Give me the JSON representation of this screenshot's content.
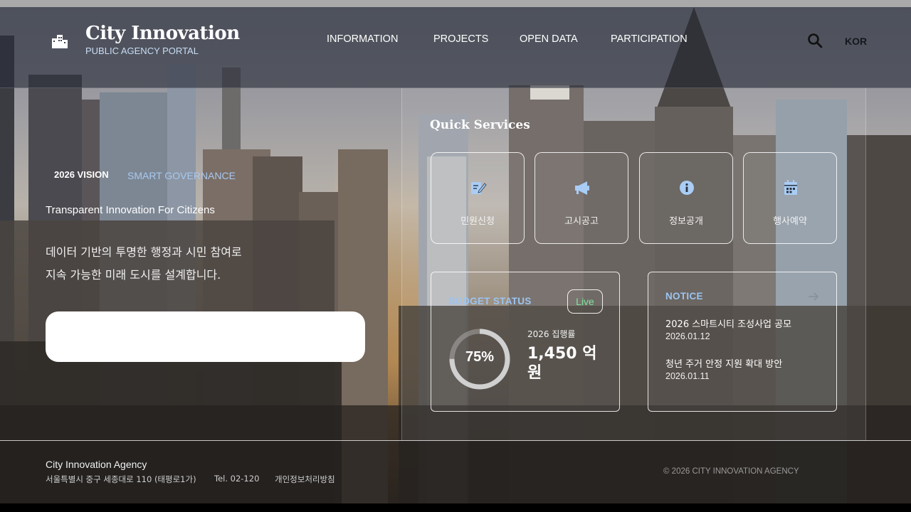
{
  "header": {
    "brand_title": "City Innovation",
    "brand_subtitle": "PUBLIC AGENCY PORTAL",
    "nav": [
      "INFORMATION",
      "PROJECTS",
      "OPEN DATA",
      "PARTICIPATION"
    ],
    "language": "KOR"
  },
  "hero": {
    "tag_primary": "2026 VISION",
    "tag_secondary": "SMART GOVERNANCE",
    "subtitle": "Transparent Innovation For Citizens",
    "body_line1": "데이터 기반의 투명한 행정과 시민 참여로",
    "body_line2": "지속 가능한 미래 도시를 설계합니다."
  },
  "quick_services": {
    "title": "Quick Services",
    "items": [
      {
        "label": "민원신청",
        "icon": "edit-document-icon"
      },
      {
        "label": "고시공고",
        "icon": "megaphone-icon"
      },
      {
        "label": "정보공개",
        "icon": "info-circle-icon"
      },
      {
        "label": "행사예약",
        "icon": "calendar-icon"
      }
    ]
  },
  "budget": {
    "label": "BUDGET STATUS",
    "live": "Live",
    "percent": 75,
    "percent_text": "75%",
    "exec_label": "2026 집행률",
    "exec_value": "1,450 억원"
  },
  "notice": {
    "label": "NOTICE",
    "items": [
      {
        "title": "2026 스마트시티 조성사업 공모",
        "date": "2026.01.12"
      },
      {
        "title": "청년 주거 안정 지원 확대 방안",
        "date": "2026.01.11"
      }
    ]
  },
  "footer": {
    "agency": "City Innovation Agency",
    "address": "서울특별시 중구 세종대로 110 (태평로1가)",
    "tel": "Tel. 02-120",
    "privacy": "개인정보처리방침",
    "copyright": "© 2026 CITY INNOVATION AGENCY"
  },
  "colors": {
    "accent_blue": "#9cc4f0",
    "live_green": "#7fe39d",
    "header_bg": "#282c38"
  }
}
